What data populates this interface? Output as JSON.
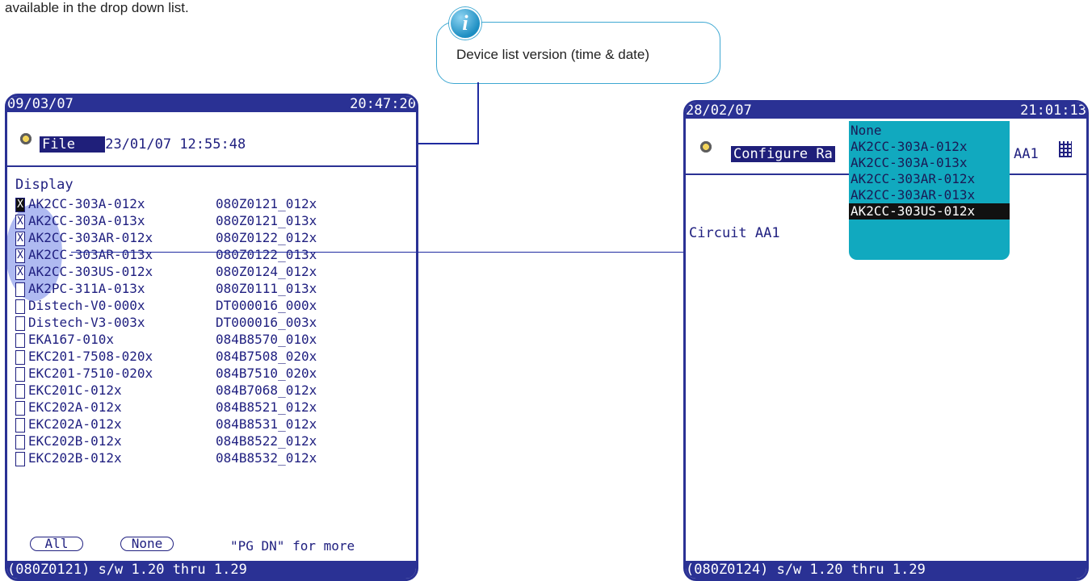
{
  "intro_text": "available in the drop down list.",
  "callout": {
    "text": "Device list version (time & date)",
    "icon": "info-icon"
  },
  "left_screen": {
    "date": "09/03/07",
    "time": "20:47:20",
    "file_label": "File",
    "file_datetime": "23/01/07 12:55:48",
    "section_label": "Display",
    "rows": [
      {
        "checked": true,
        "name": "AK2CC-303A-012x",
        "code": "080Z0121_012x"
      },
      {
        "checked": true,
        "name": "AK2CC-303A-013x",
        "code": "080Z0121_013x"
      },
      {
        "checked": true,
        "name": "AK2CC-303AR-012x",
        "code": "080Z0122_012x"
      },
      {
        "checked": true,
        "name": "AK2CC-303AR-013x",
        "code": "080Z0122_013x"
      },
      {
        "checked": true,
        "name": "AK2CC-303US-012x",
        "code": "080Z0124_012x"
      },
      {
        "checked": false,
        "name": "AK2PC-311A-013x",
        "code": "080Z0111_013x"
      },
      {
        "checked": false,
        "name": "Distech-V0-000x",
        "code": "DT000016_000x"
      },
      {
        "checked": false,
        "name": "Distech-V3-003x",
        "code": "DT000016_003x"
      },
      {
        "checked": false,
        "name": "EKA167-010x",
        "code": "084B8570_010x"
      },
      {
        "checked": false,
        "name": "EKC201-7508-020x",
        "code": "084B7508_020x"
      },
      {
        "checked": false,
        "name": "EKC201-7510-020x",
        "code": "084B7510_020x"
      },
      {
        "checked": false,
        "name": "EKC201C-012x",
        "code": "084B7068_012x"
      },
      {
        "checked": false,
        "name": "EKC202A-012x",
        "code": "084B8521_012x"
      },
      {
        "checked": false,
        "name": "EKC202A-012x",
        "code": "084B8531_012x"
      },
      {
        "checked": false,
        "name": "EKC202B-012x",
        "code": "084B8522_012x"
      },
      {
        "checked": false,
        "name": "EKC202B-012x",
        "code": "084B8532_012x"
      }
    ],
    "check_mark": "X",
    "btn_all": "All",
    "btn_none": "None",
    "more_hint": "\"PG DN\" for more",
    "status": "(080Z0121) s/w 1.20 thru 1.29"
  },
  "right_screen": {
    "date": "28/02/07",
    "time": "21:01:13",
    "header_label": "Configure Ra",
    "header_suffix": "AA1",
    "circuit_label": "Circuit AA1",
    "dropdown_options": [
      {
        "label": "None",
        "selected": false
      },
      {
        "label": "AK2CC-303A-012x",
        "selected": false
      },
      {
        "label": "AK2CC-303A-013x",
        "selected": false
      },
      {
        "label": "AK2CC-303AR-012x",
        "selected": false
      },
      {
        "label": "AK2CC-303AR-013x",
        "selected": false
      },
      {
        "label": "AK2CC-303US-012x",
        "selected": true
      }
    ],
    "status": "(080Z0124) s/w 1.20 thru 1.29"
  }
}
